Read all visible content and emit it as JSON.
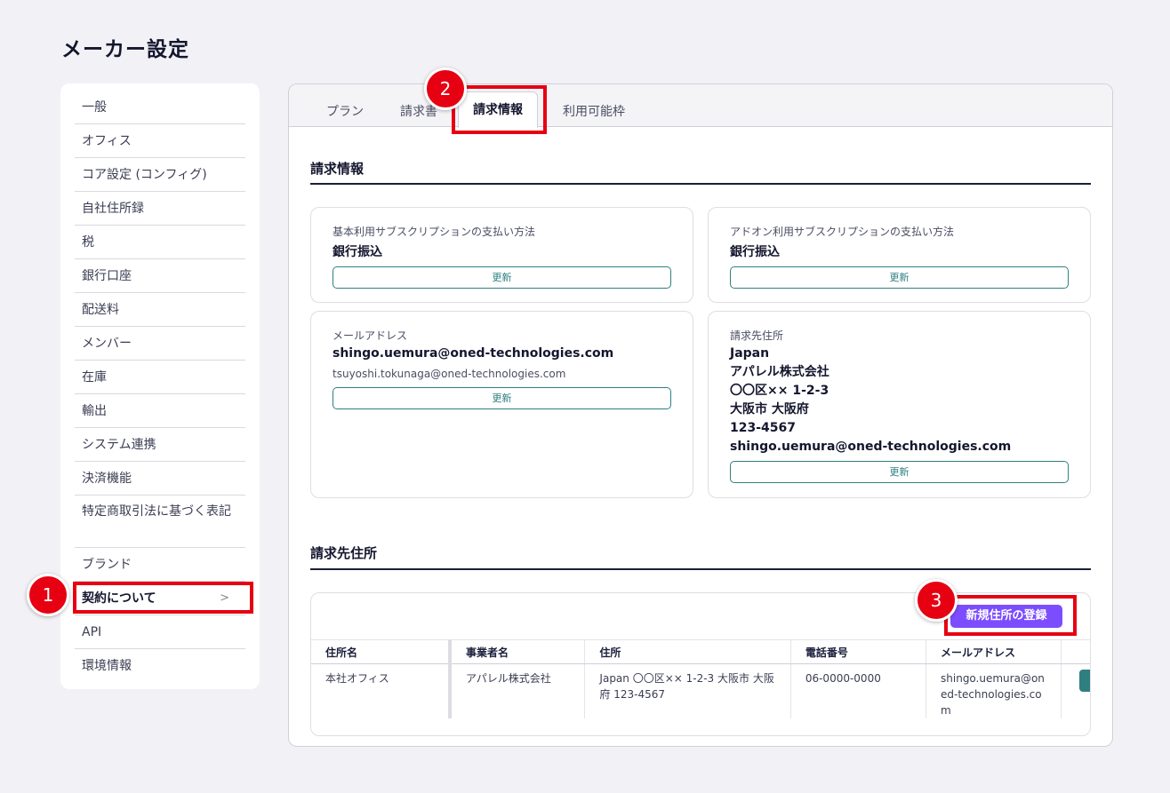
{
  "page_title": "メーカー設定",
  "sidebar": {
    "items": [
      {
        "label": "一般"
      },
      {
        "label": "オフィス"
      },
      {
        "label": "コア設定 (コンフィグ)"
      },
      {
        "label": "自社住所録"
      },
      {
        "label": "税"
      },
      {
        "label": "銀行口座"
      },
      {
        "label": "配送料"
      },
      {
        "label": "メンバー"
      },
      {
        "label": "在庫"
      },
      {
        "label": "輸出"
      },
      {
        "label": "システム連携"
      },
      {
        "label": "決済機能"
      },
      {
        "label": "特定商取引法に基づく表記"
      },
      {
        "label": "ブランド"
      },
      {
        "label": "契約について",
        "chevron": ">"
      },
      {
        "label": "API"
      },
      {
        "label": "環境情報"
      }
    ]
  },
  "tabs": [
    {
      "label": "プラン"
    },
    {
      "label": "請求書"
    },
    {
      "label": "請求情報"
    },
    {
      "label": "利用可能枠"
    }
  ],
  "billing_section": {
    "title": "請求情報",
    "basic_payment": {
      "label": "基本利用サブスクリプションの支払い方法",
      "value": "銀行振込",
      "button": "更新"
    },
    "addon_payment": {
      "label": "アドオン利用サブスクリプションの支払い方法",
      "value": "銀行振込",
      "button": "更新"
    },
    "email": {
      "label": "メールアドレス",
      "value": "shingo.uemura@oned-technologies.com",
      "cc": "tsuyoshi.tokunaga@oned-technologies.com",
      "button": "更新"
    },
    "billing_address": {
      "label": "請求先住所",
      "lines": [
        "Japan",
        "アパレル株式会社",
        "〇〇区×× 1-2-3",
        "大阪市 大阪府",
        "123-4567",
        "shingo.uemura@oned-technologies.com"
      ],
      "button": "更新"
    }
  },
  "address_section": {
    "title": "請求先住所",
    "register_button": "新規住所の登録",
    "columns": [
      "住所名",
      "事業者名",
      "住所",
      "電話番号",
      "メールアドレス"
    ],
    "rows": [
      {
        "name": "本社オフィス",
        "company": "アパレル株式会社",
        "address": "Japan 〇〇区×× 1-2-3 大阪市 大阪府 123-4567",
        "phone": "06-0000-0000",
        "email": "shingo.uemura@oned-technologies.com"
      }
    ]
  },
  "annotations": [
    {
      "number": "1"
    },
    {
      "number": "2"
    },
    {
      "number": "3"
    }
  ],
  "colors": {
    "accent_teal": "#2f7f80",
    "register_purple": "#7c4dff",
    "annotation_red": "#e60012"
  }
}
